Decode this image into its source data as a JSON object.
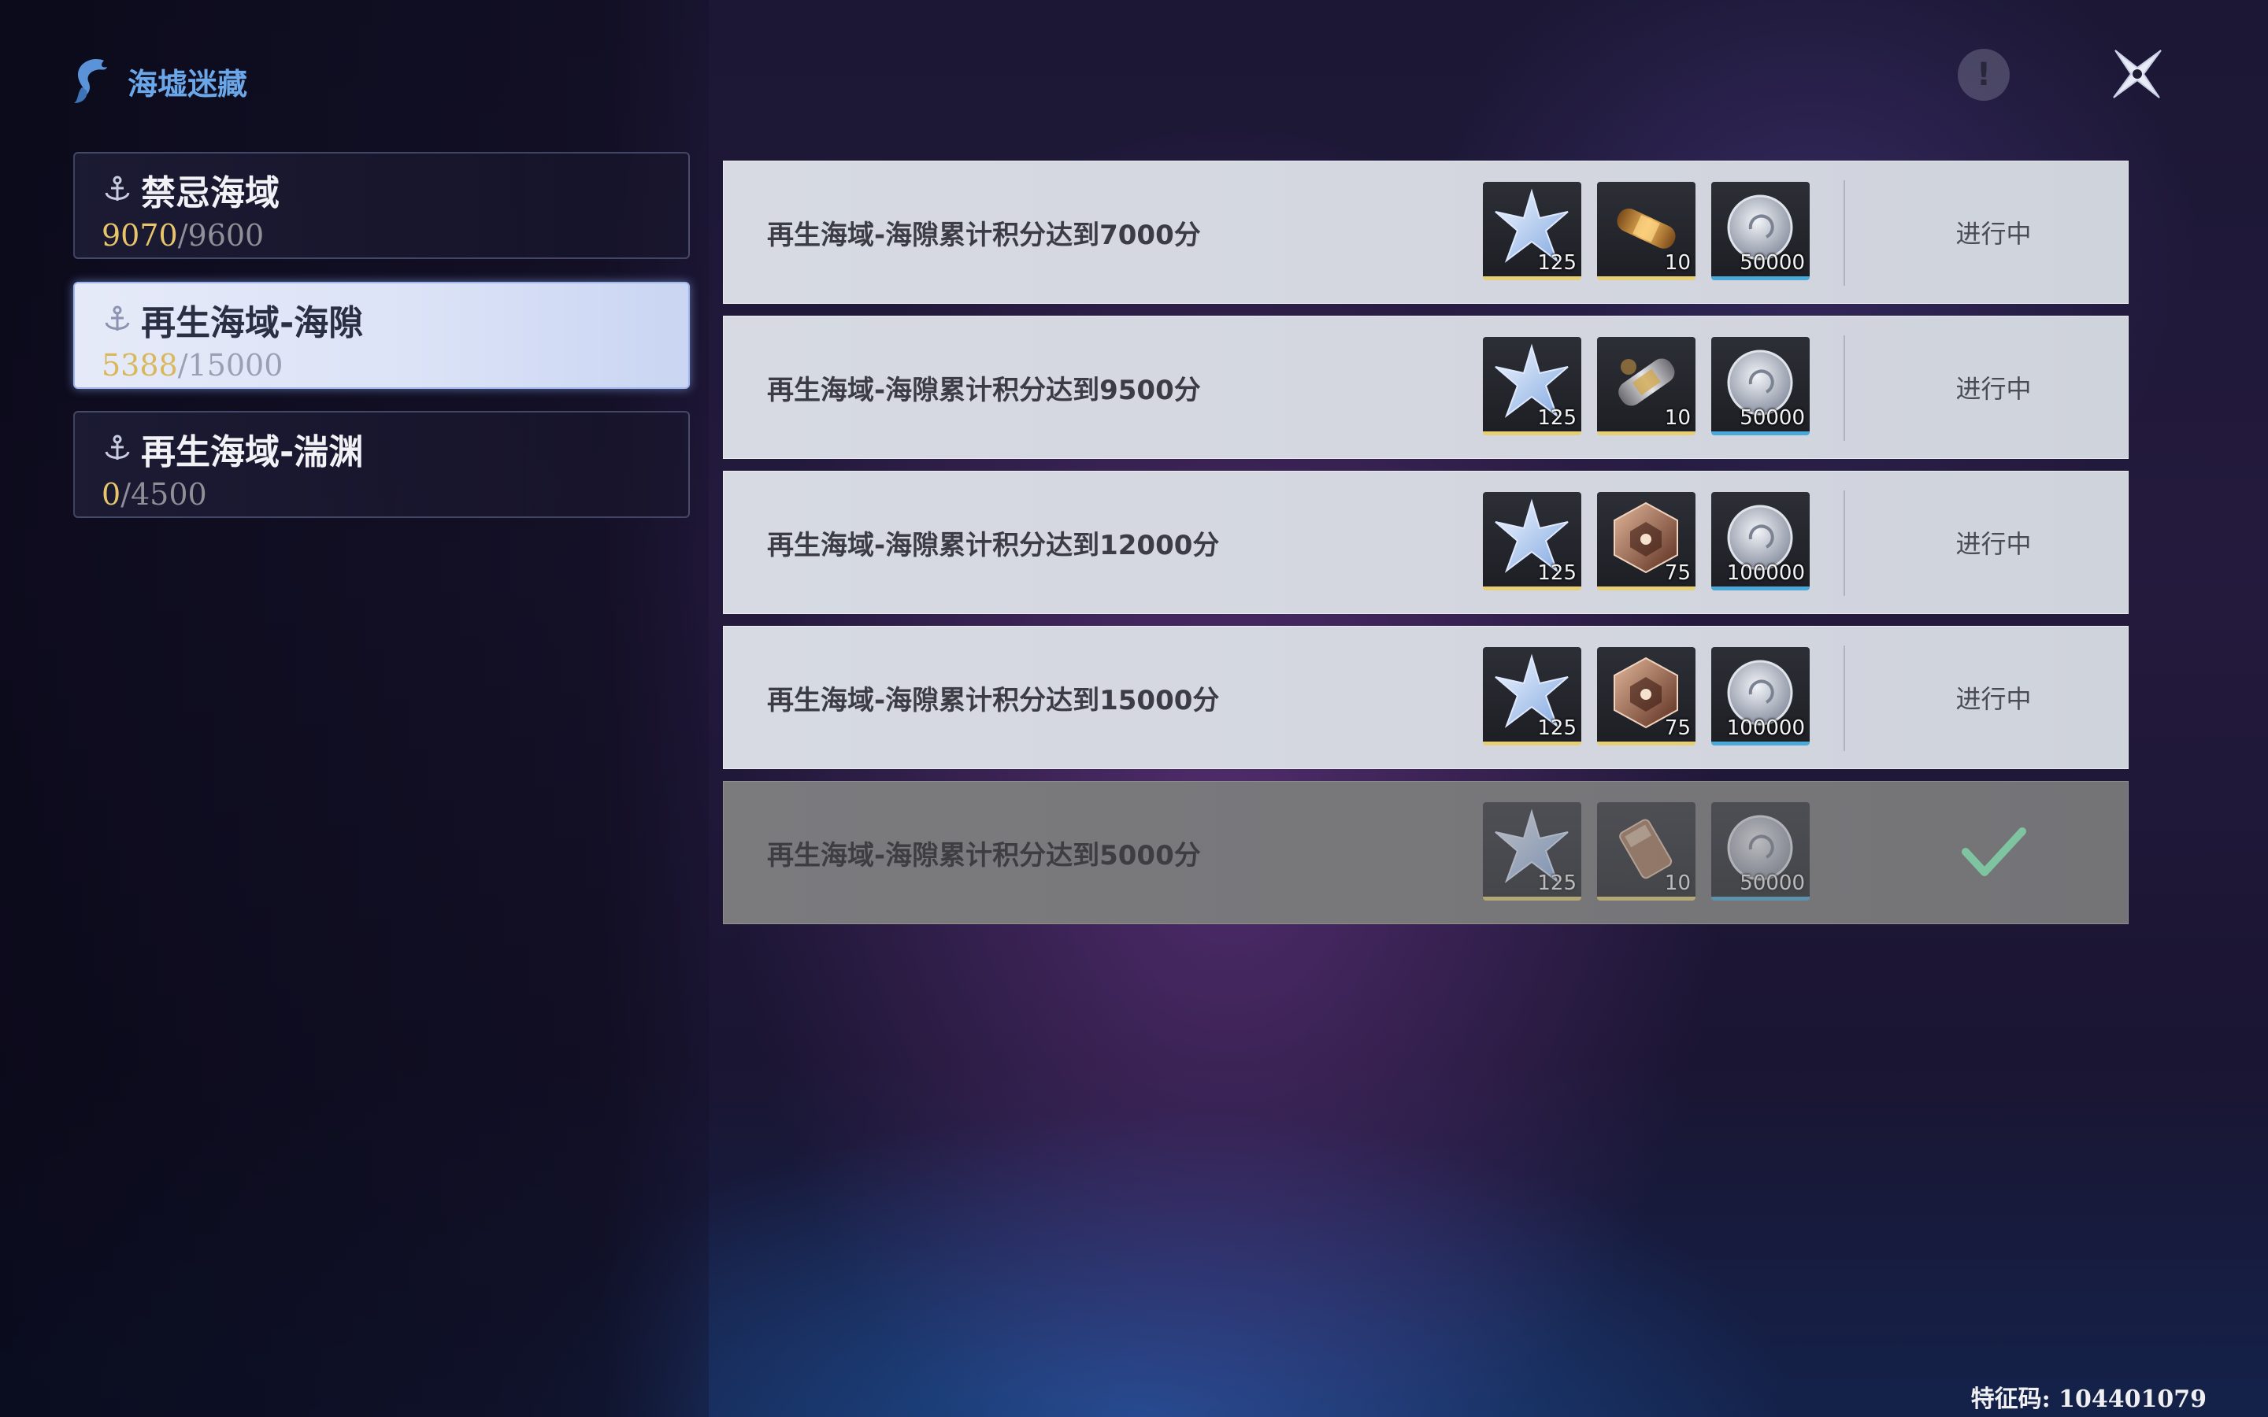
{
  "header": {
    "title": "海墟迷藏",
    "title_color": "#6aa6e8"
  },
  "regions": [
    {
      "name": "禁忌海域",
      "current": "9070",
      "sep": "/",
      "max": "9600",
      "active": false
    },
    {
      "name": "再生海域-海隙",
      "current": "5388",
      "sep": "/",
      "max": "15000",
      "active": true
    },
    {
      "name": "再生海域-湍渊",
      "current": "0",
      "sep": "/",
      "max": "4500",
      "active": false
    }
  ],
  "tasks": [
    {
      "desc": "再生海域-海隙累计积分达到7000分",
      "rewards": [
        {
          "icon": "star-crystal-icon",
          "count": "125"
        },
        {
          "icon": "gold-capsule-icon",
          "count": "10"
        },
        {
          "icon": "silver-coin-icon",
          "count": "50000"
        }
      ],
      "status": "进行中",
      "done": false
    },
    {
      "desc": "再生海域-海隙累计积分达到9500分",
      "rewards": [
        {
          "icon": "star-crystal-icon",
          "count": "125"
        },
        {
          "icon": "silver-capsule-icon",
          "count": "10"
        },
        {
          "icon": "silver-coin-icon",
          "count": "50000"
        }
      ],
      "status": "进行中",
      "done": false
    },
    {
      "desc": "再生海域-海隙累计积分达到12000分",
      "rewards": [
        {
          "icon": "star-crystal-icon",
          "count": "125"
        },
        {
          "icon": "treasure-box-icon",
          "count": "75"
        },
        {
          "icon": "silver-coin-icon",
          "count": "100000"
        }
      ],
      "status": "进行中",
      "done": false
    },
    {
      "desc": "再生海域-海隙累计积分达到15000分",
      "rewards": [
        {
          "icon": "star-crystal-icon",
          "count": "125"
        },
        {
          "icon": "treasure-box-icon",
          "count": "75"
        },
        {
          "icon": "silver-coin-icon",
          "count": "100000"
        }
      ],
      "status": "进行中",
      "done": false
    },
    {
      "desc": "再生海域-海隙累计积分达到5000分",
      "rewards": [
        {
          "icon": "star-crystal-icon",
          "count": "125"
        },
        {
          "icon": "ammo-pack-icon",
          "count": "10"
        },
        {
          "icon": "silver-coin-icon",
          "count": "50000"
        }
      ],
      "status": "",
      "done": true
    }
  ],
  "footer": {
    "code": "特征码: 104401079"
  }
}
